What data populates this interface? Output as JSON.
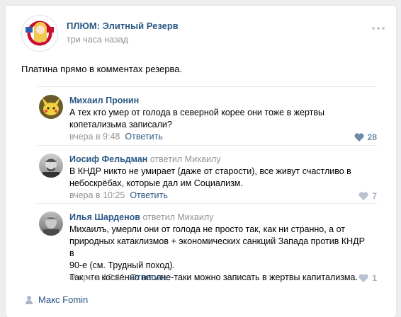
{
  "post": {
    "group_name": "ПЛЮМ: Элитный Резерв",
    "time": "три часа назад",
    "text": "Платина прямо в комментах резерва."
  },
  "comments": [
    {
      "author": "Михаил Пронин",
      "replied_to": "",
      "text_lines": [
        "А тех кто умер от голода в северной корее они тоже в жертвы",
        "копетализьма записали?"
      ],
      "time": "вчера в 9:48",
      "reply_label": "Ответить",
      "likes": "28",
      "avatar_icon": "pikachu-avatar"
    },
    {
      "author": "Иосиф Фельдман",
      "replied_to": "ответил Михаилу",
      "text_lines": [
        "В КНДР никто не умирает (даже от старости), все живут счастливо в",
        "небоскрёбах, которые дал им Социализм."
      ],
      "time": "вчера в 10:25",
      "reply_label": "Ответить",
      "likes": "7",
      "avatar_icon": "portrait-avatar"
    },
    {
      "author": "Илья Шарденов",
      "replied_to": "ответил Михаилу",
      "text_lines": [
        "Михаилъ, умерли они от голода не просто так, как ни странно, а от",
        "природных катаклизмов + экономических санкций Запада против КНДР в",
        "90-е (см. Трудный поход).",
        "Так что косвенно вполне-таки можно записать в жертвы капитализма."
      ],
      "time": "вчера в 10:41",
      "reply_label": "Ответить",
      "likes": "1",
      "avatar_icon": "portrait-avatar"
    }
  ],
  "footer": {
    "author": "Макс Fomin",
    "icon": "user-icon"
  },
  "colors": {
    "link": "#2a5885",
    "meta": "#939393",
    "like": "#6f8aa7"
  }
}
